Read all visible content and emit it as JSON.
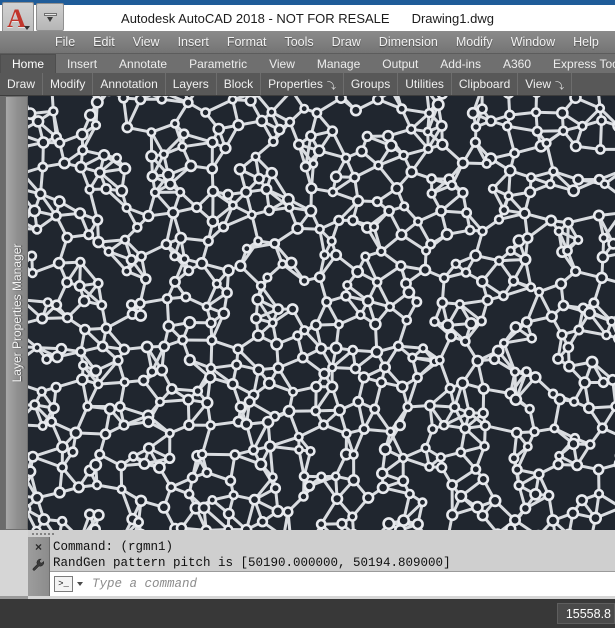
{
  "window": {
    "title": "Autodesk AutoCAD 2018 - NOT FOR RESALE",
    "document": "Drawing1.dwg",
    "accent_blue": "#1f5c99",
    "titlebar_bg": "#ffffff",
    "logo_letter": "A"
  },
  "menubar": {
    "items": [
      {
        "label": "File"
      },
      {
        "label": "Edit"
      },
      {
        "label": "View"
      },
      {
        "label": "Insert"
      },
      {
        "label": "Format"
      },
      {
        "label": "Tools"
      },
      {
        "label": "Draw"
      },
      {
        "label": "Dimension"
      },
      {
        "label": "Modify"
      },
      {
        "label": "Window"
      },
      {
        "label": "Help"
      },
      {
        "label": "Ex"
      }
    ]
  },
  "ribbon": {
    "tabs": [
      {
        "label": "Home",
        "active": true
      },
      {
        "label": "Insert",
        "active": false
      },
      {
        "label": "Annotate",
        "active": false
      },
      {
        "label": "Parametric",
        "active": false
      },
      {
        "label": "View",
        "active": false
      },
      {
        "label": "Manage",
        "active": false
      },
      {
        "label": "Output",
        "active": false
      },
      {
        "label": "Add-ins",
        "active": false
      },
      {
        "label": "A360",
        "active": false
      },
      {
        "label": "Express Tools",
        "active": false
      }
    ],
    "panels": [
      {
        "label": "Draw",
        "arrow": ""
      },
      {
        "label": "Modify",
        "arrow": ""
      },
      {
        "label": "Annotation",
        "arrow": ""
      },
      {
        "label": "Layers",
        "arrow": ""
      },
      {
        "label": "Block",
        "arrow": ""
      },
      {
        "label": "Properties",
        "arrow": "⤵"
      },
      {
        "label": "Groups",
        "arrow": ""
      },
      {
        "label": "Utilities",
        "arrow": ""
      },
      {
        "label": "Clipboard",
        "arrow": ""
      },
      {
        "label": "View",
        "arrow": "⤵"
      }
    ]
  },
  "palette": {
    "label": "Layer Properties Manager"
  },
  "canvas": {
    "background_color": "#20262f",
    "line_color": "#e8eaee",
    "pattern_name": "randgen-voronoi-cell-pattern"
  },
  "command_window": {
    "history": [
      "Command: (rgmn1)",
      "RandGen pattern pitch is [50190.000000, 50194.809000]"
    ],
    "prompt_glyph": ">_",
    "input_value": "",
    "input_placeholder": "Type a command",
    "close_icon_label": "×"
  },
  "statusbar": {
    "coordinate": "15558.8"
  }
}
